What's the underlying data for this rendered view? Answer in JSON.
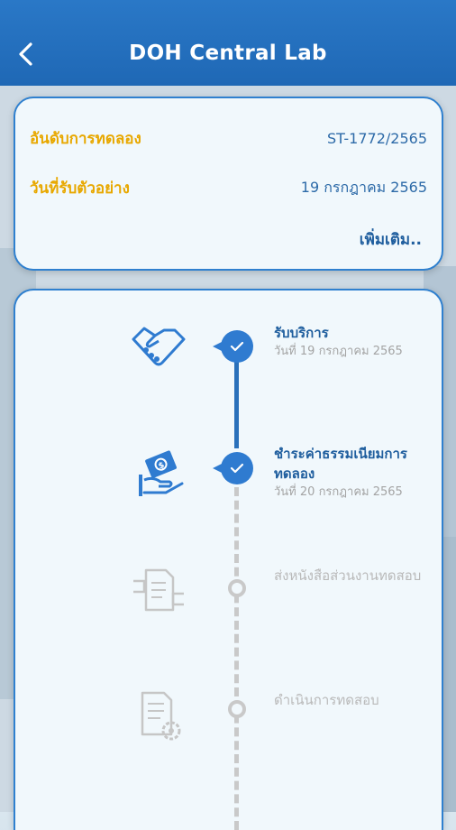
{
  "header": {
    "title": "DOH Central Lab"
  },
  "info_card": {
    "rows": [
      {
        "label": "อันดับการทดลอง",
        "value": "ST-1772/2565"
      },
      {
        "label": "วันที่รับตัวอย่าง",
        "value": "19 กรกฎาคม 2565"
      }
    ],
    "more_label": "เพิ่มเติม.."
  },
  "timeline": {
    "steps": [
      {
        "title": "รับบริการ",
        "date": "วันที่ 19 กรกฎาคม 2565",
        "status": "done",
        "icon": "handshake-icon"
      },
      {
        "title": "ชำระค่าธรรมเนียมการทดลอง",
        "date": "วันที่ 20 กรกฎาคม 2565",
        "status": "done",
        "icon": "payment-hand-icon"
      },
      {
        "title": "ส่งหนังสือส่วนงานทดสอบ",
        "date": "",
        "status": "pending",
        "icon": "document-exchange-icon"
      },
      {
        "title": "ดำเนินการทดสอบ",
        "date": "",
        "status": "pending",
        "icon": "document-gear-icon"
      }
    ]
  },
  "colors": {
    "header": "#2a78c7",
    "accent_label": "#e8a800",
    "primary_text": "#1f5e9e",
    "inactive": "#c9c9c9"
  }
}
